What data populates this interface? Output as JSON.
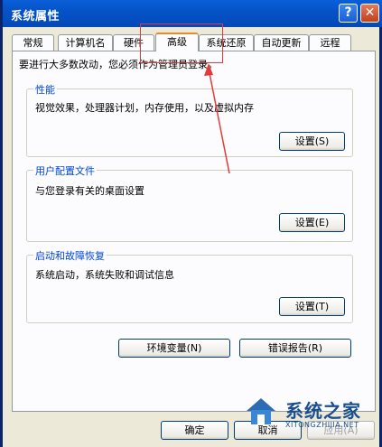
{
  "window": {
    "title": "系统属性",
    "help_label": "?",
    "close_label": "✕"
  },
  "tabs": [
    {
      "label": "常规"
    },
    {
      "label": "计算机名"
    },
    {
      "label": "硬件"
    },
    {
      "label": "高级",
      "active": true
    },
    {
      "label": "系统还原"
    },
    {
      "label": "自动更新"
    },
    {
      "label": "远程"
    }
  ],
  "admin_note": "要进行大多数改动，您必须作为管理员登录。",
  "groups": {
    "performance": {
      "title": "性能",
      "description": "视觉效果，处理器计划，内存使用，以及虚拟内存",
      "button": "设置(S)"
    },
    "user_profiles": {
      "title": "用户配置文件",
      "description": "与您登录有关的桌面设置",
      "button": "设置(E)"
    },
    "startup_recovery": {
      "title": "启动和故障恢复",
      "description": "系统启动，系统失败和调试信息",
      "button": "设置(T)"
    }
  },
  "action_buttons": {
    "env_vars": "环境变量(N)",
    "error_report": "错误报告(R)"
  },
  "dialog_buttons": {
    "ok": "确定",
    "cancel": "取消",
    "apply": "应用(A)"
  },
  "watermark": {
    "text": "系统之家",
    "url": "XITONGZHIJIA.NET"
  },
  "colors": {
    "titlebar": "#0553c8",
    "group_title": "#0046d5",
    "annotation": "#e23b3b",
    "active_tab_accent": "#e68b2c"
  }
}
